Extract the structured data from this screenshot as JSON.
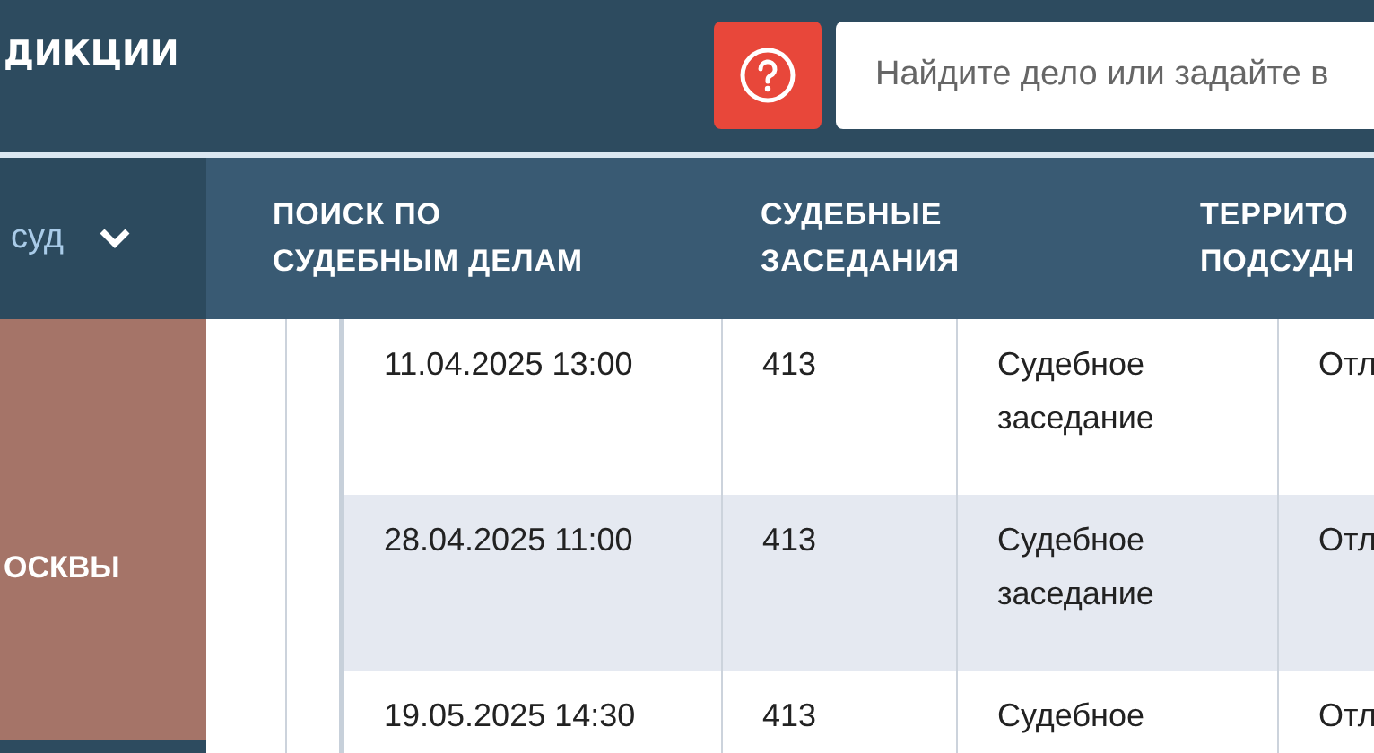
{
  "header": {
    "title": "ДИКЦИИ",
    "search": {
      "placeholder": "Найдите дело или задайте в"
    }
  },
  "nav": {
    "court_select": "суд",
    "items": [
      {
        "label": "ПОИСК ПО СУДЕБНЫМ ДЕЛАМ"
      },
      {
        "label": "СУДЕБНЫЕ ЗАСЕДАНИЯ"
      },
      {
        "label": "ТЕРРИТО ПОДСУДН"
      }
    ]
  },
  "side_panel": {
    "text": "ОСКВЫ"
  },
  "table": {
    "rows": [
      {
        "date": "11.04.2025 13:00",
        "room": "413",
        "event": "Судебное заседание",
        "column_4": "Отл"
      },
      {
        "date": "28.04.2025 11:00",
        "room": "413",
        "event": "Судебное заседание",
        "column_4": "Отл"
      },
      {
        "date": "19.05.2025 14:30",
        "room": "413",
        "event": "Судебное",
        "column_4": "Отл"
      }
    ]
  }
}
